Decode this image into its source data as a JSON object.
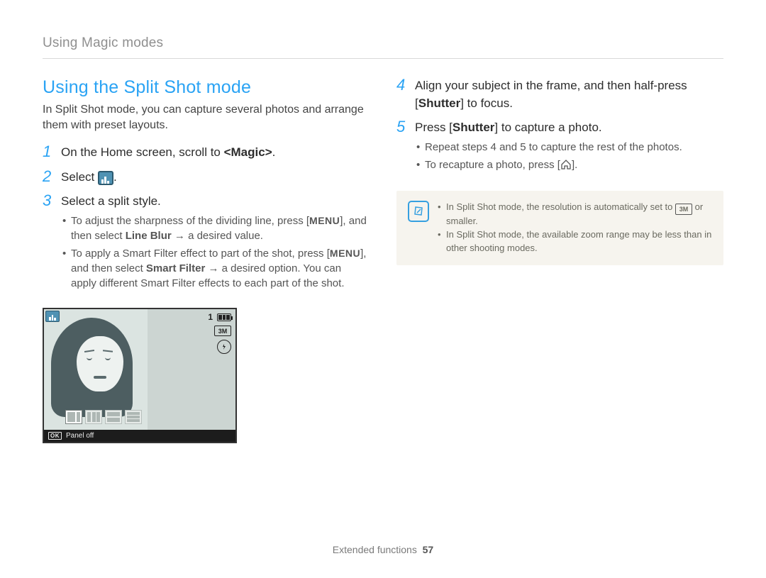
{
  "page": {
    "running_head": "Using Magic modes",
    "footer_section": "Extended functions",
    "footer_page": "57"
  },
  "left": {
    "section_title": "Using the Split Shot mode",
    "intro": "In Split Shot mode, you can capture several photos and arrange them with preset layouts.",
    "step1_pre": "On the Home screen, scroll to ",
    "step1_bold": "<Magic>",
    "step1_post": ".",
    "step2_pre": "Select ",
    "step2_post": ".",
    "step3": "Select a split style.",
    "step3_sub1_pre": "To adjust the sharpness of the dividing line, press [",
    "step3_sub1_menu": "MENU",
    "step3_sub1_mid": "], and then select ",
    "step3_sub1_b": "Line Blur",
    "step3_sub1_post": " → a desired value.",
    "step3_sub2_pre": "To apply a Smart Filter effect to part of the shot, press [",
    "step3_sub2_menu": "MENU",
    "step3_sub2_mid": "], and then select ",
    "step3_sub2_b": "Smart Filter",
    "step3_sub2_post": " → a desired option. You can apply different Smart Filter effects to each part of the shot.",
    "lcd": {
      "count": "1",
      "size_label": "3M",
      "ok": "OK",
      "bar_text": "Panel off"
    }
  },
  "right": {
    "step4_pre": "Align your subject in the frame, and then half-press [",
    "step4_b": "Shutter",
    "step4_post": "] to focus.",
    "step5_pre": "Press [",
    "step5_b": "Shutter",
    "step5_post": "] to capture a photo.",
    "step5_sub1": "Repeat steps 4 and 5 to capture the rest of the photos.",
    "step5_sub2_pre": "To recapture a photo, press [",
    "step5_sub2_post": "].",
    "note1_pre": "In Split Shot mode, the resolution is automatically set to ",
    "note1_label": "3M",
    "note1_post": " or smaller.",
    "note2": "In Split Shot mode, the available zoom range may be less than in other shooting modes."
  }
}
